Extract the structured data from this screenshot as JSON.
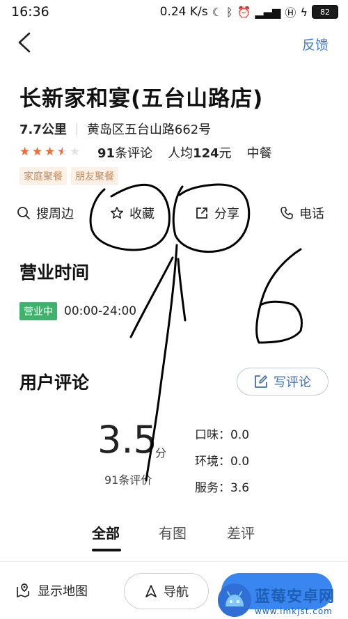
{
  "status_bar": {
    "time": "16:36",
    "network_speed": "0.24 K/s",
    "battery": "82"
  },
  "nav": {
    "feedback_label": "反馈"
  },
  "shop": {
    "name": "长新家和宴(五台山路店)",
    "distance": "7.7公里",
    "address": "黄岛区五台山路662号",
    "rating_stars": 3.5,
    "reviews_prefix": "91",
    "reviews_suffix": "条评论",
    "avg_prefix": "人均",
    "avg_value": "124",
    "avg_suffix": "元",
    "cuisine": "中餐",
    "tags": [
      "家庭聚餐",
      "朋友聚餐"
    ]
  },
  "actions": {
    "search_nearby": "搜周边",
    "favorite": "收藏",
    "share": "分享",
    "call": "电话"
  },
  "hours": {
    "title": "营业时间",
    "status": "营业中",
    "time": "00:00-24:00"
  },
  "reviews": {
    "title": "用户评论",
    "write_label": "写评论",
    "score": "3.5",
    "score_unit": "分",
    "count_text": "91条评价",
    "taste": "口味：0.0",
    "environment": "环境：0.0",
    "service": "服务：3.6"
  },
  "tabs": [
    "全部",
    "有图",
    "差评"
  ],
  "bottom_bar": {
    "show_map": "显示地图",
    "navigate": "导航"
  },
  "watermark": {
    "title": "蓝莓安卓网",
    "url": "www.lmkjst.com"
  },
  "colors": {
    "accent_blue": "#3d7bd9",
    "star_orange": "#f36c35",
    "open_green": "#3fb36b",
    "tag_text": "#c48a5c"
  }
}
